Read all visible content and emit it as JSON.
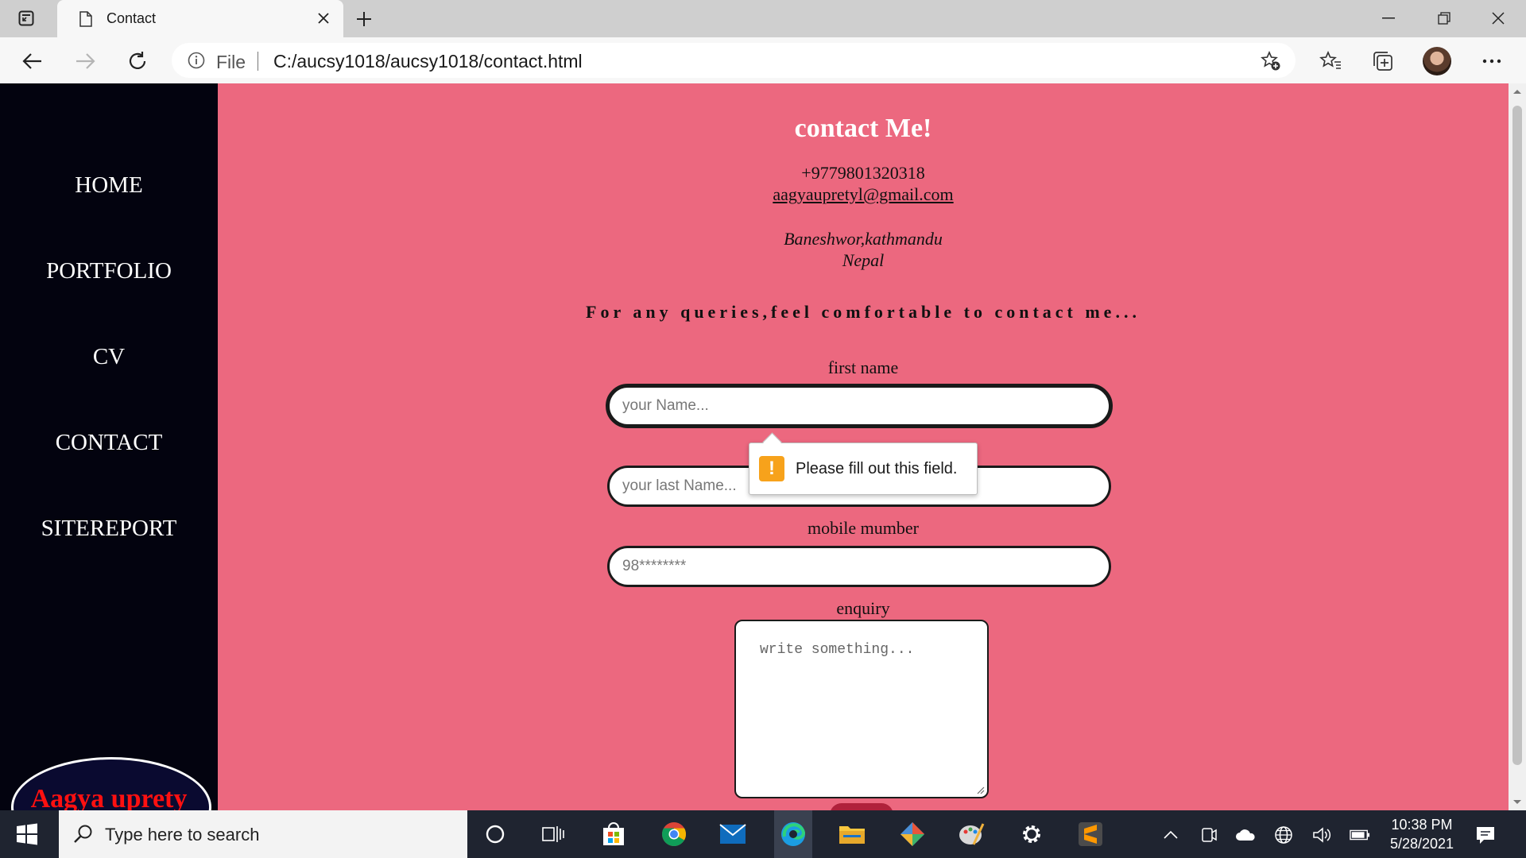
{
  "browser": {
    "tab_title": "Contact",
    "address_scheme": "File",
    "address_url": "C:/aucsy1018/aucsy1018/contact.html"
  },
  "sidebar": {
    "items": [
      {
        "label": "HOME"
      },
      {
        "label": "PORTFOLIO"
      },
      {
        "label": "CV"
      },
      {
        "label": "CONTACT"
      },
      {
        "label": "SITEREPORT"
      }
    ],
    "logo_text": "Aagya uprety"
  },
  "main": {
    "heading": "contact Me!",
    "phone": "+9779801320318",
    "email": "aagyaupretyl@gmail.com",
    "address_line1": "Baneshwor,kathmandu",
    "address_line2": "Nepal",
    "tagline": "For any queries,feel comfortable to contact me...",
    "form": {
      "first_name_label": "first name",
      "first_name_placeholder": "your Name...",
      "last_name_placeholder": "your last Name...",
      "mobile_label": "mobile mumber",
      "mobile_placeholder": "98********",
      "enquiry_label": "enquiry",
      "enquiry_placeholder": "write something..."
    },
    "validation_message": "Please fill out this field."
  },
  "taskbar": {
    "search_placeholder": "Type here to search",
    "time": "10:38 PM",
    "date": "5/28/2021"
  },
  "colors": {
    "page_background": "#ec687f",
    "sidebar_background": "#03030f",
    "warning_icon": "#f7a21b"
  }
}
